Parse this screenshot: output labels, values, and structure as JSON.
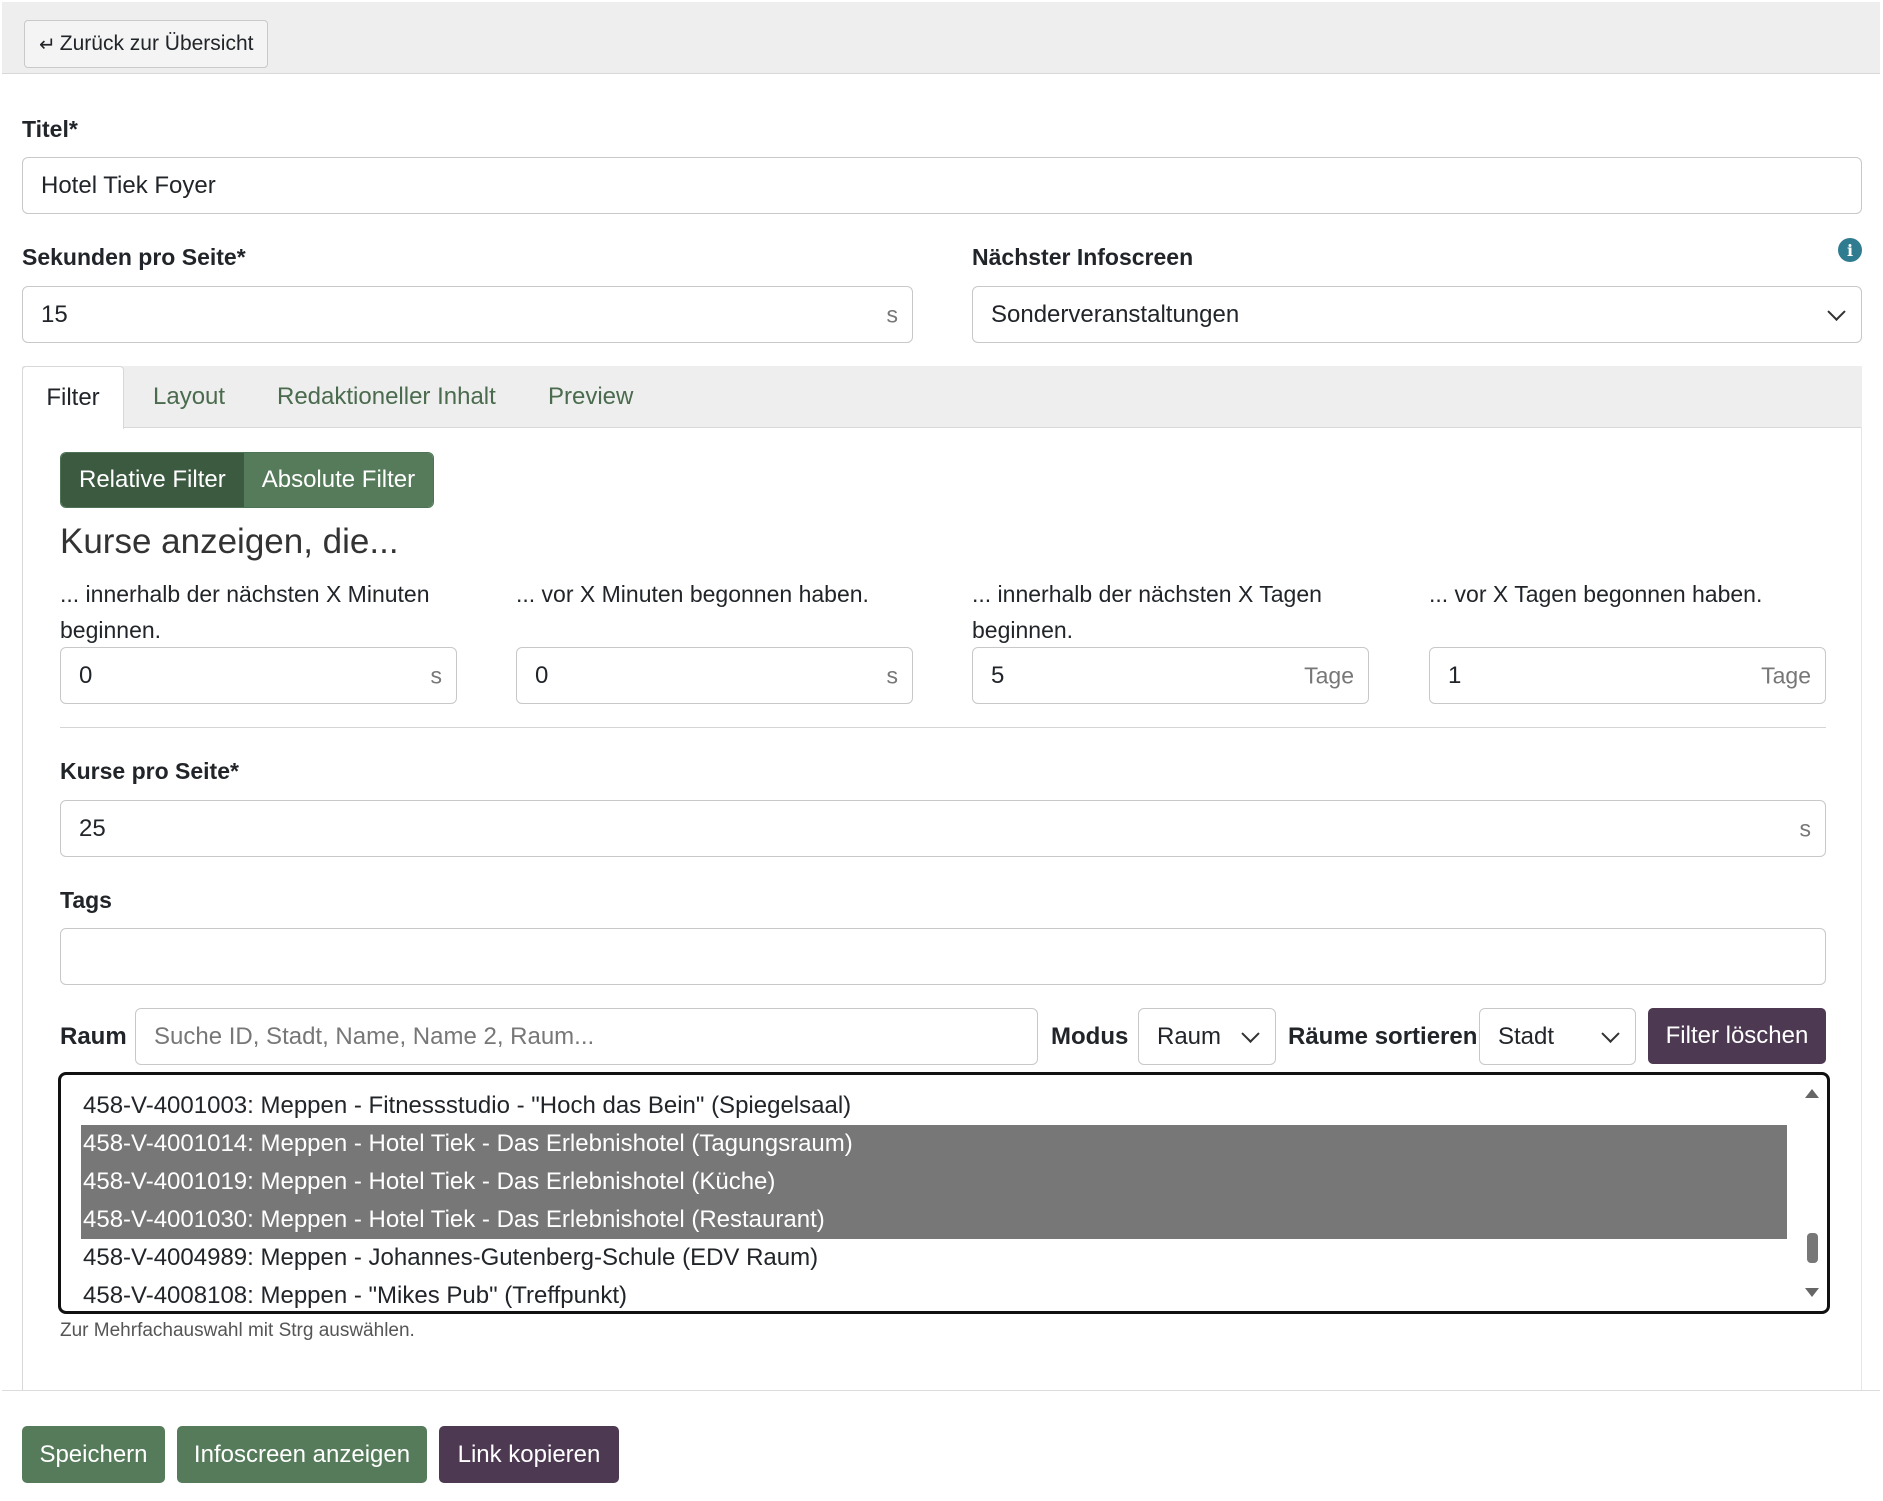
{
  "topbar": {
    "back_label": "Zurück zur Übersicht",
    "back_icon": "return-arrow-icon"
  },
  "title": {
    "label": "Titel*",
    "value": "Hotel Tiek Foyer"
  },
  "seconds": {
    "label": "Sekunden pro Seite*",
    "value": "15",
    "unit": "s"
  },
  "next_screen": {
    "label": "Nächster Infoscreen",
    "value": "Sonderveranstaltungen",
    "info_icon": "info-icon"
  },
  "tabs": [
    {
      "label": "Filter",
      "active": true
    },
    {
      "label": "Layout",
      "active": false
    },
    {
      "label": "Redaktioneller Inhalt",
      "active": false
    },
    {
      "label": "Preview",
      "active": false
    }
  ],
  "filter_toggle": {
    "relative": "Relative Filter",
    "absolute": "Absolute Filter"
  },
  "heading": "Kurse anzeigen, die...",
  "filters": [
    {
      "label": "... innerhalb der nächsten X Minuten beginnen.",
      "value": "0",
      "unit": "s"
    },
    {
      "label": "... vor X Minuten begonnen haben.",
      "value": "0",
      "unit": "s"
    },
    {
      "label": "... innerhalb der nächsten X Tagen beginnen.",
      "value": "5",
      "unit": "Tage"
    },
    {
      "label": "... vor X Tagen begonnen haben.",
      "value": "1",
      "unit": "Tage"
    }
  ],
  "courses_per_page": {
    "label": "Kurse pro Seite*",
    "value": "25",
    "unit": "s"
  },
  "tags": {
    "label": "Tags",
    "value": ""
  },
  "raum": {
    "label": "Raum",
    "search_placeholder": "Suche ID, Stadt, Name, Name 2, Raum...",
    "modus_label": "Modus",
    "modus_value": "Raum",
    "sort_label": "Räume sortieren",
    "sort_value": "Stadt",
    "clear_label": "Filter löschen"
  },
  "room_list": [
    {
      "text": "458-V-4001003: Meppen - Fitnessstudio - \"Hoch das Bein\" (Spiegelsaal)",
      "selected": false
    },
    {
      "text": "458-V-4001014: Meppen - Hotel Tiek - Das Erlebnishotel (Tagungsraum)",
      "selected": true
    },
    {
      "text": "458-V-4001019: Meppen - Hotel Tiek - Das Erlebnishotel (Küche)",
      "selected": true
    },
    {
      "text": "458-V-4001030: Meppen - Hotel Tiek - Das Erlebnishotel (Restaurant)",
      "selected": true
    },
    {
      "text": "458-V-4004989: Meppen - Johannes-Gutenberg-Schule (EDV Raum)",
      "selected": false
    },
    {
      "text": "458-V-4008108: Meppen - \"Mikes Pub\" (Treffpunkt)",
      "selected": false
    }
  ],
  "hint": "Zur Mehrfachauswahl mit Strg auswählen.",
  "footer": {
    "save": "Speichern",
    "show": "Infoscreen anzeigen",
    "copy": "Link kopieren"
  },
  "colors": {
    "green": "#557b5a",
    "dark_green": "#3b5a40",
    "purple": "#4d3a52",
    "selection": "#777777"
  }
}
